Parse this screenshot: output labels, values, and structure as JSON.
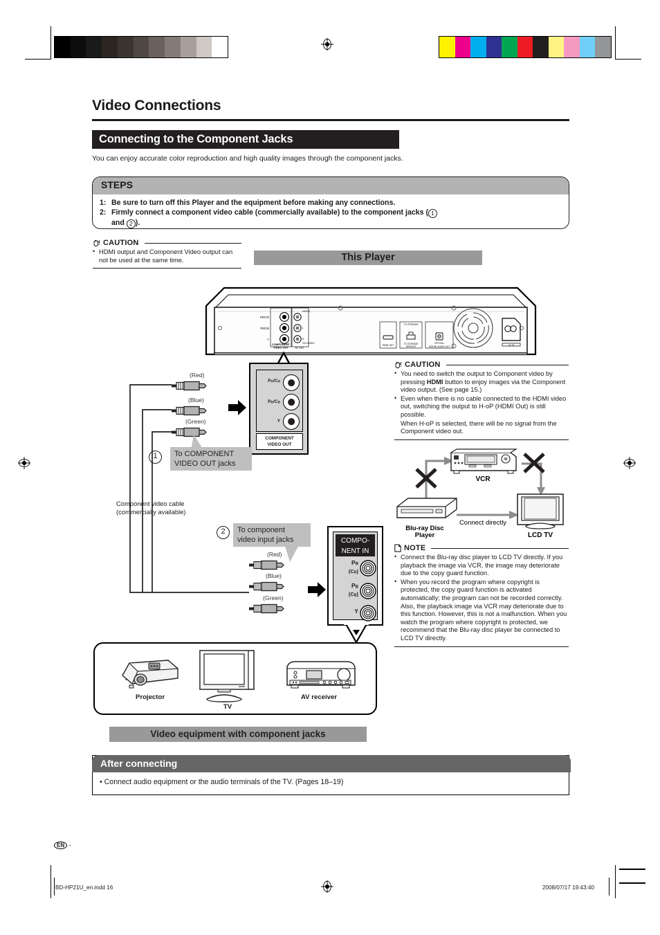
{
  "print_marks": {
    "grayscale_swatches": [
      "#000000",
      "#0d0d0d",
      "#1a1a1a",
      "#2b2622",
      "#3b3531",
      "#4f4743",
      "#6b615c",
      "#857b76",
      "#a89f9a",
      "#cfc8c3",
      "#ffffff"
    ],
    "color_swatches": [
      "#fff200",
      "#ec008c",
      "#00aeef",
      "#2e3192",
      "#00a651",
      "#ed1c24",
      "#231f20",
      "#fff385",
      "#f49ac1",
      "#6fcff6",
      "#939598"
    ]
  },
  "page": {
    "title": "Video Connections",
    "section_heading": "Connecting to the Component Jacks",
    "lead": "You can enjoy accurate color reproduction and high quality images through the component jacks."
  },
  "steps": {
    "heading": "STEPS",
    "items": [
      {
        "num": "1:",
        "text": "Be sure to turn off this Player and the equipment before making any connections."
      },
      {
        "num": "2:",
        "text_a": "Firmly connect a component video cable (commercially available) to the component jacks (",
        "circ_a": "1",
        "text_b": "",
        "text_c": "and",
        "circ_b": "2",
        "text_d": ")."
      }
    ]
  },
  "caution_left": {
    "icon": "hand-caution-icon",
    "label": "CAUTION",
    "items": [
      "HDMI output and Component Video output can not be used at the same time."
    ]
  },
  "caution_right": {
    "icon": "hand-caution-icon",
    "label": "CAUTION",
    "items": [
      "You need to switch the output to Component video by pressing HDMI button to enjoy images via the Component video output. (See page 15.)",
      "Even when there is no cable connected to the HDMI video out, switching the output to H-oP (HDMI Out) is still possible.",
      "When H-oP is selected, there will be no signal from the Component video out."
    ],
    "bold_word": "HDMI"
  },
  "note_right": {
    "icon": "note-page-icon",
    "label": "NOTE",
    "items": [
      "Connect the Blu-ray disc player to LCD TV directly. If you playback the image via VCR, the image may deteriorate due to the copy guard function.",
      "When you record the program where copyright is protected, the copy guard function is activated automatically; the program can not be recorded correctly. Also, the playback image via VCR may deteriorate due to this function. However, this is not a malfunction. When you watch the program where copyright is protected, we recommend that the Blu-ray disc player be connected to LCD TV directly."
    ]
  },
  "player": {
    "bar_label": "This Player",
    "rear_ports": [
      "COMPONENT VIDEO OUT",
      "AV OUT",
      "VIDEO",
      "2CH AUDIO",
      "HDMI OUT",
      "TO STORAGE SERVICE",
      "OPTICAL DIGITAL AUDIO OUT",
      "AC IN"
    ]
  },
  "out_panel": {
    "jacks": [
      {
        "label": "PR/CR"
      },
      {
        "label": "PB/CB"
      },
      {
        "label": "Y"
      }
    ],
    "footer_line1": "COMPONENT",
    "footer_line2": "VIDEO OUT"
  },
  "in_panel": {
    "header_line1": "COMPO-",
    "header_line2": "NENT IN",
    "jacks": [
      {
        "label": "PR",
        "sub": "(CR)"
      },
      {
        "label": "PB",
        "sub": "(CB)"
      },
      {
        "label": "Y",
        "sub": ""
      }
    ]
  },
  "callouts": {
    "step1_num": "1",
    "step1_line1": "To COMPONENT",
    "step1_line2": "VIDEO OUT jacks",
    "step2_num": "2",
    "step2_line1": "To component",
    "step2_line2": "video input jacks",
    "cable_line1": "Component video cable",
    "cable_line2": "(commercially available)"
  },
  "plug_labels_top": [
    "(Red)",
    "(Blue)",
    "(Green)"
  ],
  "plug_labels_bottom": [
    "(Red)",
    "(Blue)",
    "(Green)"
  ],
  "copyguard_diagram": {
    "vcr_label": "VCR",
    "player_label_line1": "Blu-ray Disc",
    "player_label_line2": "Player",
    "tv_label": "LCD TV",
    "connect_label": "Connect directly"
  },
  "equipment": {
    "items": [
      {
        "label": "Projector",
        "icon": "projector-icon"
      },
      {
        "label": "TV",
        "icon": "tv-icon"
      },
      {
        "label": "AV receiver",
        "icon": "av-receiver-icon"
      }
    ],
    "bar_label": "Video equipment with component jacks"
  },
  "after_connecting": {
    "heading": "After connecting",
    "body": "• Connect audio equipment or the audio terminals of the TV. (Pages 18–19)"
  },
  "footer": {
    "en_mark": "EN",
    "en_dash": "-",
    "file": "BD-HP21U_en.indd   16",
    "timestamp": "2008/07/17   19:43:40"
  }
}
